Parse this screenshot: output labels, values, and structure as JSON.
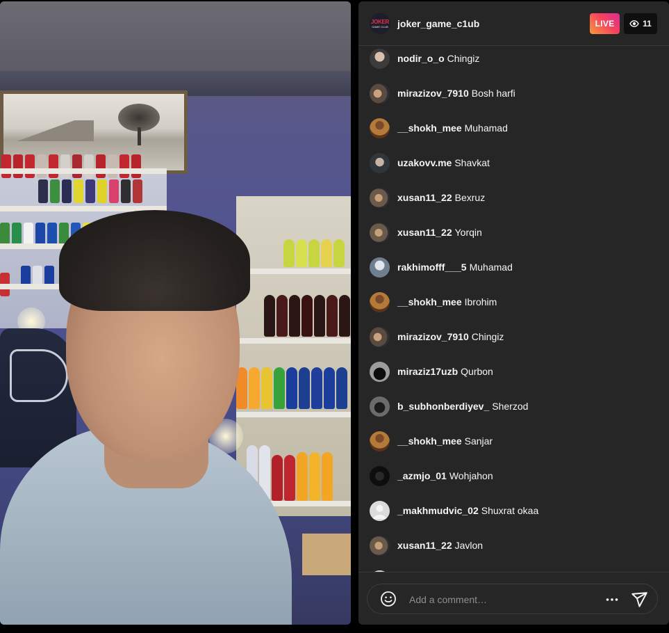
{
  "stream": {
    "host_username": "joker_game_c1ub",
    "host_avatar_text_top": "JOKER",
    "host_avatar_text_bottom": "GAME CLUB",
    "live_label": "LIVE",
    "viewer_count": "11",
    "viewer_icon": "eye-icon"
  },
  "colors": {
    "panel_bg": "#262626",
    "live_gradient_start": "#f99a3a",
    "live_gradient_end": "#d92d92",
    "text_primary": "#f5f5f5",
    "placeholder": "#8e8e8e"
  },
  "comments": [
    {
      "user": "nodir_o_o",
      "message": "Chingiz",
      "avatar": "avatar-photo"
    },
    {
      "user": "mirazizov_7910",
      "message": "Bosh harfi",
      "avatar": "avatar-photo"
    },
    {
      "user": "__shokh_mee",
      "message": "Muhamad",
      "avatar": "avatar-photo"
    },
    {
      "user": "uzakovv.me",
      "message": "Shavkat",
      "avatar": "avatar-photo"
    },
    {
      "user": "xusan11_22",
      "message": "Bexruz",
      "avatar": "avatar-photo"
    },
    {
      "user": "xusan11_22",
      "message": "Yorqin",
      "avatar": "avatar-photo"
    },
    {
      "user": "rakhimofff___5",
      "message": "Muhamad",
      "avatar": "avatar-photo"
    },
    {
      "user": "__shokh_mee",
      "message": "Ibrohim",
      "avatar": "avatar-photo"
    },
    {
      "user": "mirazizov_7910",
      "message": "Chingiz",
      "avatar": "avatar-photo"
    },
    {
      "user": "miraziz17uzb",
      "message": "Qurbon",
      "avatar": "avatar-photo"
    },
    {
      "user": "b_subhonberdiyev_",
      "message": "Sherzod",
      "avatar": "avatar-photo"
    },
    {
      "user": "__shokh_mee",
      "message": "Sanjar",
      "avatar": "avatar-photo"
    },
    {
      "user": "_azmjo_01",
      "message": "Wohjahon",
      "avatar": "avatar-photo"
    },
    {
      "user": "_makhmudvic_02",
      "message": "Shuxrat okaa",
      "avatar": "avatar-default"
    },
    {
      "user": "xusan11_22",
      "message": "Javlon",
      "avatar": "avatar-photo"
    }
  ],
  "composer": {
    "placeholder": "Add a comment…",
    "emoji_icon": "smiley-icon",
    "more_icon": "more-options-icon",
    "send_icon": "send-icon"
  }
}
